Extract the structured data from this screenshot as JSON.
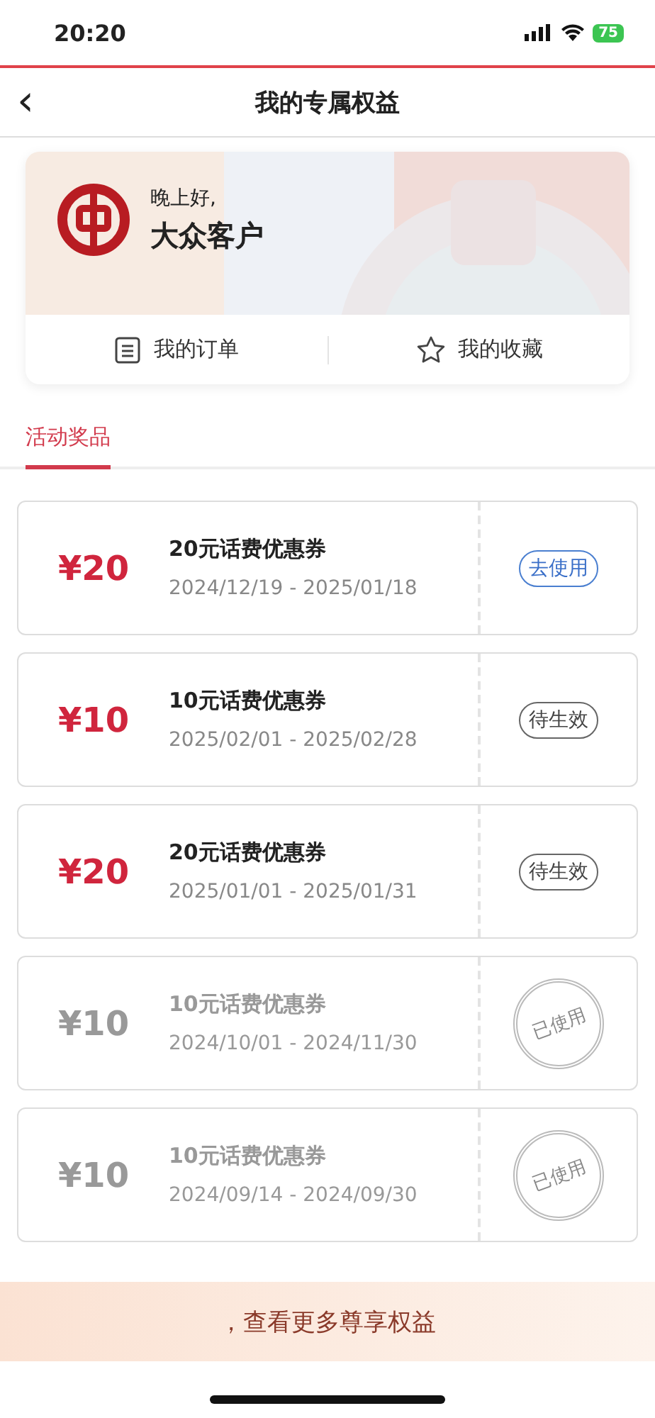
{
  "status_bar": {
    "time": "20:20",
    "battery": "75"
  },
  "nav": {
    "back": "‹",
    "title": "我的专属权益"
  },
  "profile": {
    "greeting": "晚上好,",
    "name": "大众客户",
    "actions": [
      {
        "kind": "orders",
        "label": "我的订单"
      },
      {
        "kind": "favorites",
        "label": "我的收藏"
      }
    ]
  },
  "tabs": [
    {
      "label": "活动奖品",
      "selected": true
    }
  ],
  "coupons": [
    {
      "amount": "¥20",
      "title": "20元话费优惠券",
      "dates": "2024/12/19 - 2025/01/18",
      "kind": "use",
      "action": "去使用"
    },
    {
      "amount": "¥10",
      "title": "10元话费优惠券",
      "dates": "2025/02/01 - 2025/02/28",
      "kind": "pending",
      "action": "待生效"
    },
    {
      "amount": "¥20",
      "title": "20元话费优惠券",
      "dates": "2025/01/01 - 2025/01/31",
      "kind": "pending",
      "action": "待生效"
    },
    {
      "amount": "¥10",
      "title": "10元话费优惠券",
      "dates": "2024/10/01 - 2024/11/30",
      "kind": "used",
      "action": "已使用"
    },
    {
      "amount": "¥10",
      "title": "10元话费优惠券",
      "dates": "2024/09/14 - 2024/09/30",
      "kind": "used",
      "action": "已使用"
    }
  ],
  "banner": {
    "text": "，查看更多尊享权益"
  }
}
